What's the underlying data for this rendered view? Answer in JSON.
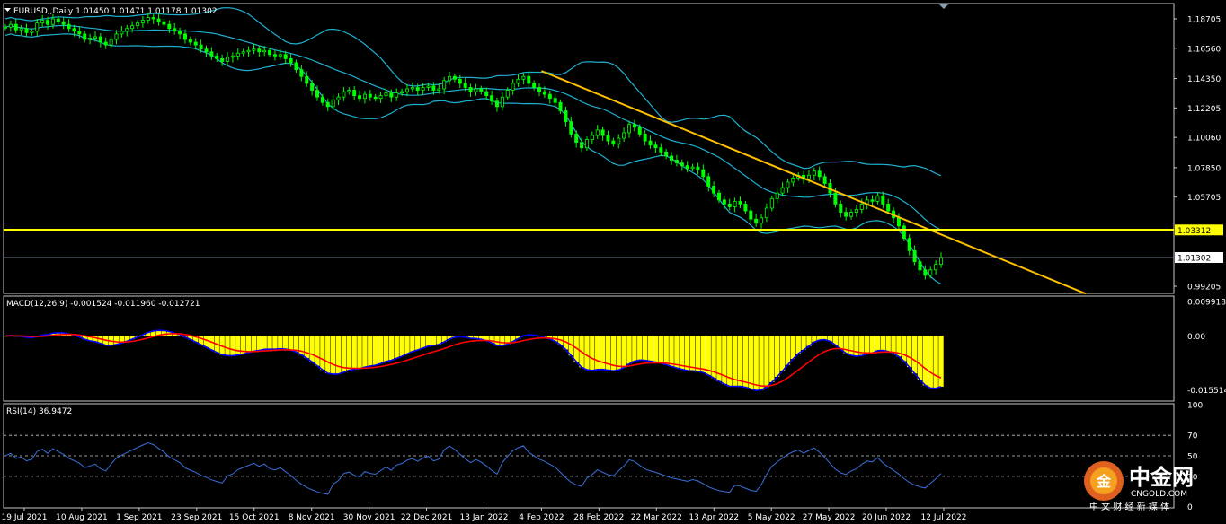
{
  "chart_data": {
    "type": "candlestick",
    "symbol_header": "EURUSD,,Daily  1.01450 1.01471 1.01178 1.01302",
    "price_axis": {
      "ticks": [
        "1.18705",
        "1.16560",
        "1.14350",
        "1.12205",
        "1.10060",
        "1.07850",
        "1.05705",
        "1.03312",
        "1.01302",
        "0.99205"
      ],
      "ylim": [
        0.9875,
        1.1975
      ]
    },
    "x_labels": [
      "19 Jul 2021",
      "10 Aug 2021",
      "1 Sep 2021",
      "23 Sep 2021",
      "15 Oct 2021",
      "8 Nov 2021",
      "30 Nov 2021",
      "22 Dec 2021",
      "13 Jan 2022",
      "4 Feb 2022",
      "28 Feb 2022",
      "22 Mar 2022",
      "13 Apr 2022",
      "5 May 2022",
      "27 May 2022",
      "20 Jun 2022",
      "12 Jul 2022"
    ],
    "close_series": [
      1.181,
      1.183,
      1.179,
      1.18,
      1.177,
      1.178,
      1.184,
      1.186,
      1.183,
      1.187,
      1.185,
      1.183,
      1.18,
      1.178,
      1.176,
      1.172,
      1.173,
      1.174,
      1.17,
      1.168,
      1.172,
      1.176,
      1.178,
      1.18,
      1.182,
      1.184,
      1.186,
      1.188,
      1.187,
      1.185,
      1.183,
      1.18,
      1.178,
      1.176,
      1.172,
      1.17,
      1.168,
      1.165,
      1.163,
      1.16,
      1.158,
      1.156,
      1.159,
      1.16,
      1.162,
      1.163,
      1.164,
      1.165,
      1.163,
      1.164,
      1.161,
      1.16,
      1.161,
      1.158,
      1.155,
      1.15,
      1.145,
      1.14,
      1.135,
      1.13,
      1.126,
      1.123,
      1.128,
      1.13,
      1.134,
      1.135,
      1.131,
      1.129,
      1.132,
      1.13,
      1.129,
      1.131,
      1.133,
      1.13,
      1.133,
      1.134,
      1.136,
      1.137,
      1.135,
      1.137,
      1.138,
      1.135,
      1.136,
      1.142,
      1.145,
      1.143,
      1.14,
      1.137,
      1.134,
      1.136,
      1.134,
      1.131,
      1.127,
      1.123,
      1.13,
      1.135,
      1.14,
      1.143,
      1.145,
      1.14,
      1.137,
      1.134,
      1.132,
      1.129,
      1.126,
      1.12,
      1.112,
      1.103,
      1.097,
      1.093,
      1.099,
      1.102,
      1.106,
      1.102,
      1.098,
      1.096,
      1.1,
      1.104,
      1.11,
      1.108,
      1.103,
      1.098,
      1.095,
      1.093,
      1.09,
      1.087,
      1.084,
      1.082,
      1.08,
      1.078,
      1.079,
      1.077,
      1.072,
      1.065,
      1.06,
      1.055,
      1.052,
      1.05,
      1.054,
      1.052,
      1.047,
      1.041,
      1.038,
      1.042,
      1.049,
      1.056,
      1.06,
      1.064,
      1.068,
      1.071,
      1.073,
      1.07,
      1.073,
      1.076,
      1.072,
      1.067,
      1.06,
      1.052,
      1.046,
      1.043,
      1.046,
      1.048,
      1.052,
      1.055,
      1.054,
      1.058,
      1.052,
      1.047,
      1.042,
      1.036,
      1.027,
      1.018,
      1.01,
      1.004,
      1.0,
      1.004,
      1.008,
      1.013
    ],
    "trendline": {
      "from": [
        "4 Feb 2022",
        1.149
      ],
      "to": [
        "12 Jul 2022",
        1.029
      ]
    },
    "horizontal_level": 1.03312,
    "current_price": 1.01302,
    "colors": {
      "candle_up": "#000000",
      "candle_down": "#00ff00",
      "candle_outline": "#00ff00",
      "bollinger": "#1fb0d0",
      "trendline": "#ffc000",
      "level": "#ffff00",
      "macd_hist": "#ffff00",
      "macd_main": "#0000ff",
      "macd_signal": "#ff0000",
      "rsi": "#3a6fd8",
      "grid_frame": "#d0d0d0"
    },
    "macd": {
      "label": "MACD(12,26,9) -0.001524 -0.011960 -0.012721",
      "ticks": [
        "0.009918",
        "0.00",
        "-0.015514"
      ],
      "ylim": [
        -0.0185,
        0.0112
      ]
    },
    "rsi": {
      "label": "RSI(14) 36.9472",
      "ticks": [
        "100",
        "70",
        "50",
        "30",
        "0"
      ],
      "levels": [
        70,
        50,
        30
      ],
      "ylim": [
        0,
        100
      ]
    }
  },
  "watermark": {
    "logo_glyph": "金",
    "brand_cn": "中金网",
    "brand_en": "CNGOLD.COM",
    "slogan": "中 文 财 经 新 媒 体"
  }
}
